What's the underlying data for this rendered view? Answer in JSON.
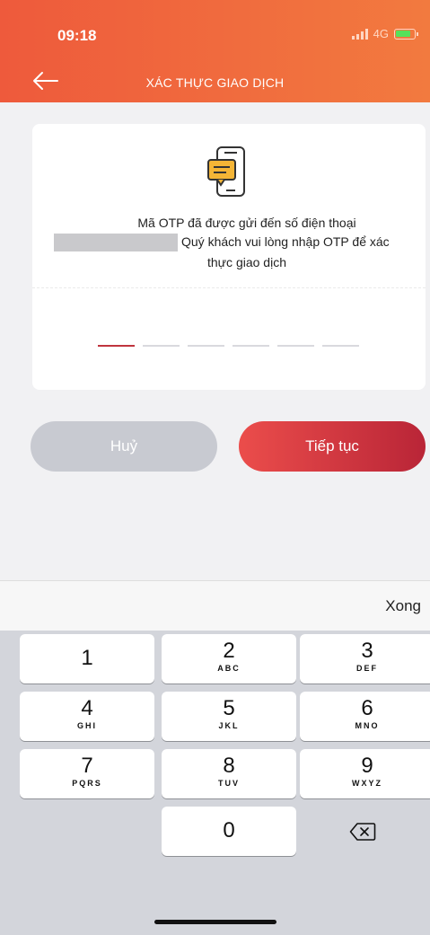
{
  "status_bar": {
    "time": "09:18",
    "network": "4G"
  },
  "header": {
    "title": "XÁC THỰC GIAO DỊCH"
  },
  "card": {
    "message_line1": "Mã OTP đã được gửi đến số điện thoại",
    "message_line2": "Quý khách vui lòng nhập OTP để xác",
    "message_line3": "thực giao dịch",
    "otp_length": 6,
    "otp_active_index": 0
  },
  "buttons": {
    "cancel": "Huỷ",
    "continue": "Tiếp tục"
  },
  "keyboard": {
    "done": "Xong",
    "keys": [
      {
        "num": "1",
        "letters": ""
      },
      {
        "num": "2",
        "letters": "ABC"
      },
      {
        "num": "3",
        "letters": "DEF"
      },
      {
        "num": "4",
        "letters": "GHI"
      },
      {
        "num": "5",
        "letters": "JKL"
      },
      {
        "num": "6",
        "letters": "MNO"
      },
      {
        "num": "7",
        "letters": "PQRS"
      },
      {
        "num": "8",
        "letters": "TUV"
      },
      {
        "num": "9",
        "letters": "WXYZ"
      },
      {
        "num": "0",
        "letters": ""
      }
    ]
  },
  "colors": {
    "header": "#ee5a3c",
    "accent": "#c0353e",
    "cancel": "#c8cad1"
  },
  "icons": {
    "back": "arrow-left-icon",
    "otp": "phone-message-icon",
    "delete": "backspace-icon"
  }
}
